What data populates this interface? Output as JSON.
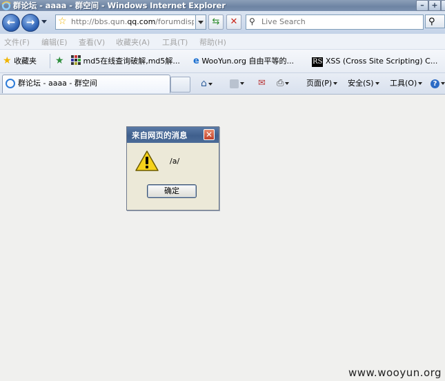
{
  "window": {
    "title": "群论坛 - aaaa - 群空间 - Windows Internet Explorer"
  },
  "address_bar": {
    "url_prefix": "http://bbs.qun.",
    "url_domain": "qq.com",
    "url_suffix": "/forumdisplay",
    "search_placeholder": "Live Search"
  },
  "menu": {
    "items": [
      "文件(F)",
      "编辑(E)",
      "查看(V)",
      "收藏夹(A)",
      "工具(T)",
      "帮助(H)"
    ]
  },
  "favorites": {
    "label": "收藏夹",
    "items": [
      {
        "label": "md5在线查询破解,md5解...",
        "icon": "grid-icon"
      },
      {
        "label": "WooYun.org  自由平等的...",
        "icon": "ie-page-icon"
      },
      {
        "label": "XSS (Cross Site Scripting) C...",
        "icon": "rs-icon"
      }
    ]
  },
  "tabs": [
    {
      "label": "群论坛 - aaaa - 群空间"
    }
  ],
  "command_bar": {
    "page": "页面(P)",
    "safety": "安全(S)",
    "tools": "工具(O)"
  },
  "dialog": {
    "title": "来自网页的消息",
    "message": "/a/",
    "ok_label": "确定",
    "icon": "warning-icon"
  },
  "watermark": "www.wooyun.org"
}
